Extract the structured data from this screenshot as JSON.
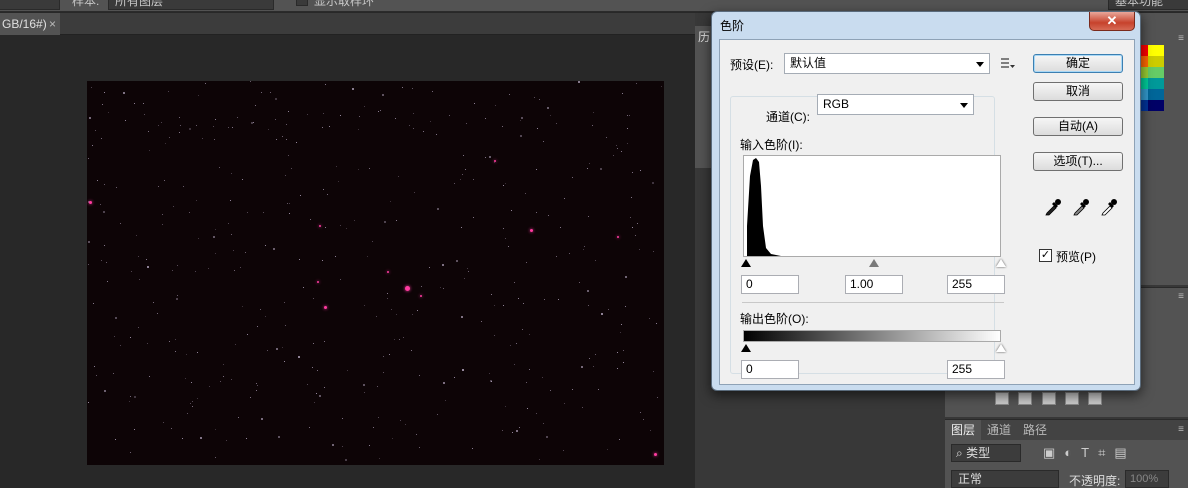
{
  "options_bar": {
    "sample_label": "样本:",
    "sample_value": "所有图层",
    "show_ring_label": "显示取样环",
    "workspace": "基本功能"
  },
  "document": {
    "tab_title": "GB/16#)",
    "close_glyph": "×"
  },
  "levels_dialog": {
    "title": "色阶",
    "close_glyph": "✕",
    "preset_label": "预设(E):",
    "preset_value": "默认值",
    "channel_label": "通道(C):",
    "channel_value": "RGB",
    "input_levels_label": "输入色阶(I):",
    "input_black": "0",
    "input_gamma": "1.00",
    "input_white": "255",
    "output_levels_label": "输出色阶(O):",
    "output_black": "0",
    "output_white": "255",
    "buttons": {
      "ok": "确定",
      "cancel": "取消",
      "auto": "自动(A)",
      "options": "选项(T)..."
    },
    "preview_label": "预览(P)",
    "preview_checked": true,
    "preview_glyph": "✓"
  },
  "side_strip_initial": "历",
  "layers_panel": {
    "tabs": [
      "图层",
      "通道",
      "路径"
    ],
    "filter_label": "类型",
    "blend_mode": "正常",
    "opacity_label": "不透明度:",
    "opacity_value": "100%"
  },
  "swatch_colors": [
    "#ff0000",
    "#ffff00",
    "#ff6600",
    "#cccc00",
    "#99cc33",
    "#66cc66",
    "#00cc99",
    "#009999",
    "#3399cc",
    "#006699",
    "#003399",
    "#000066"
  ]
}
